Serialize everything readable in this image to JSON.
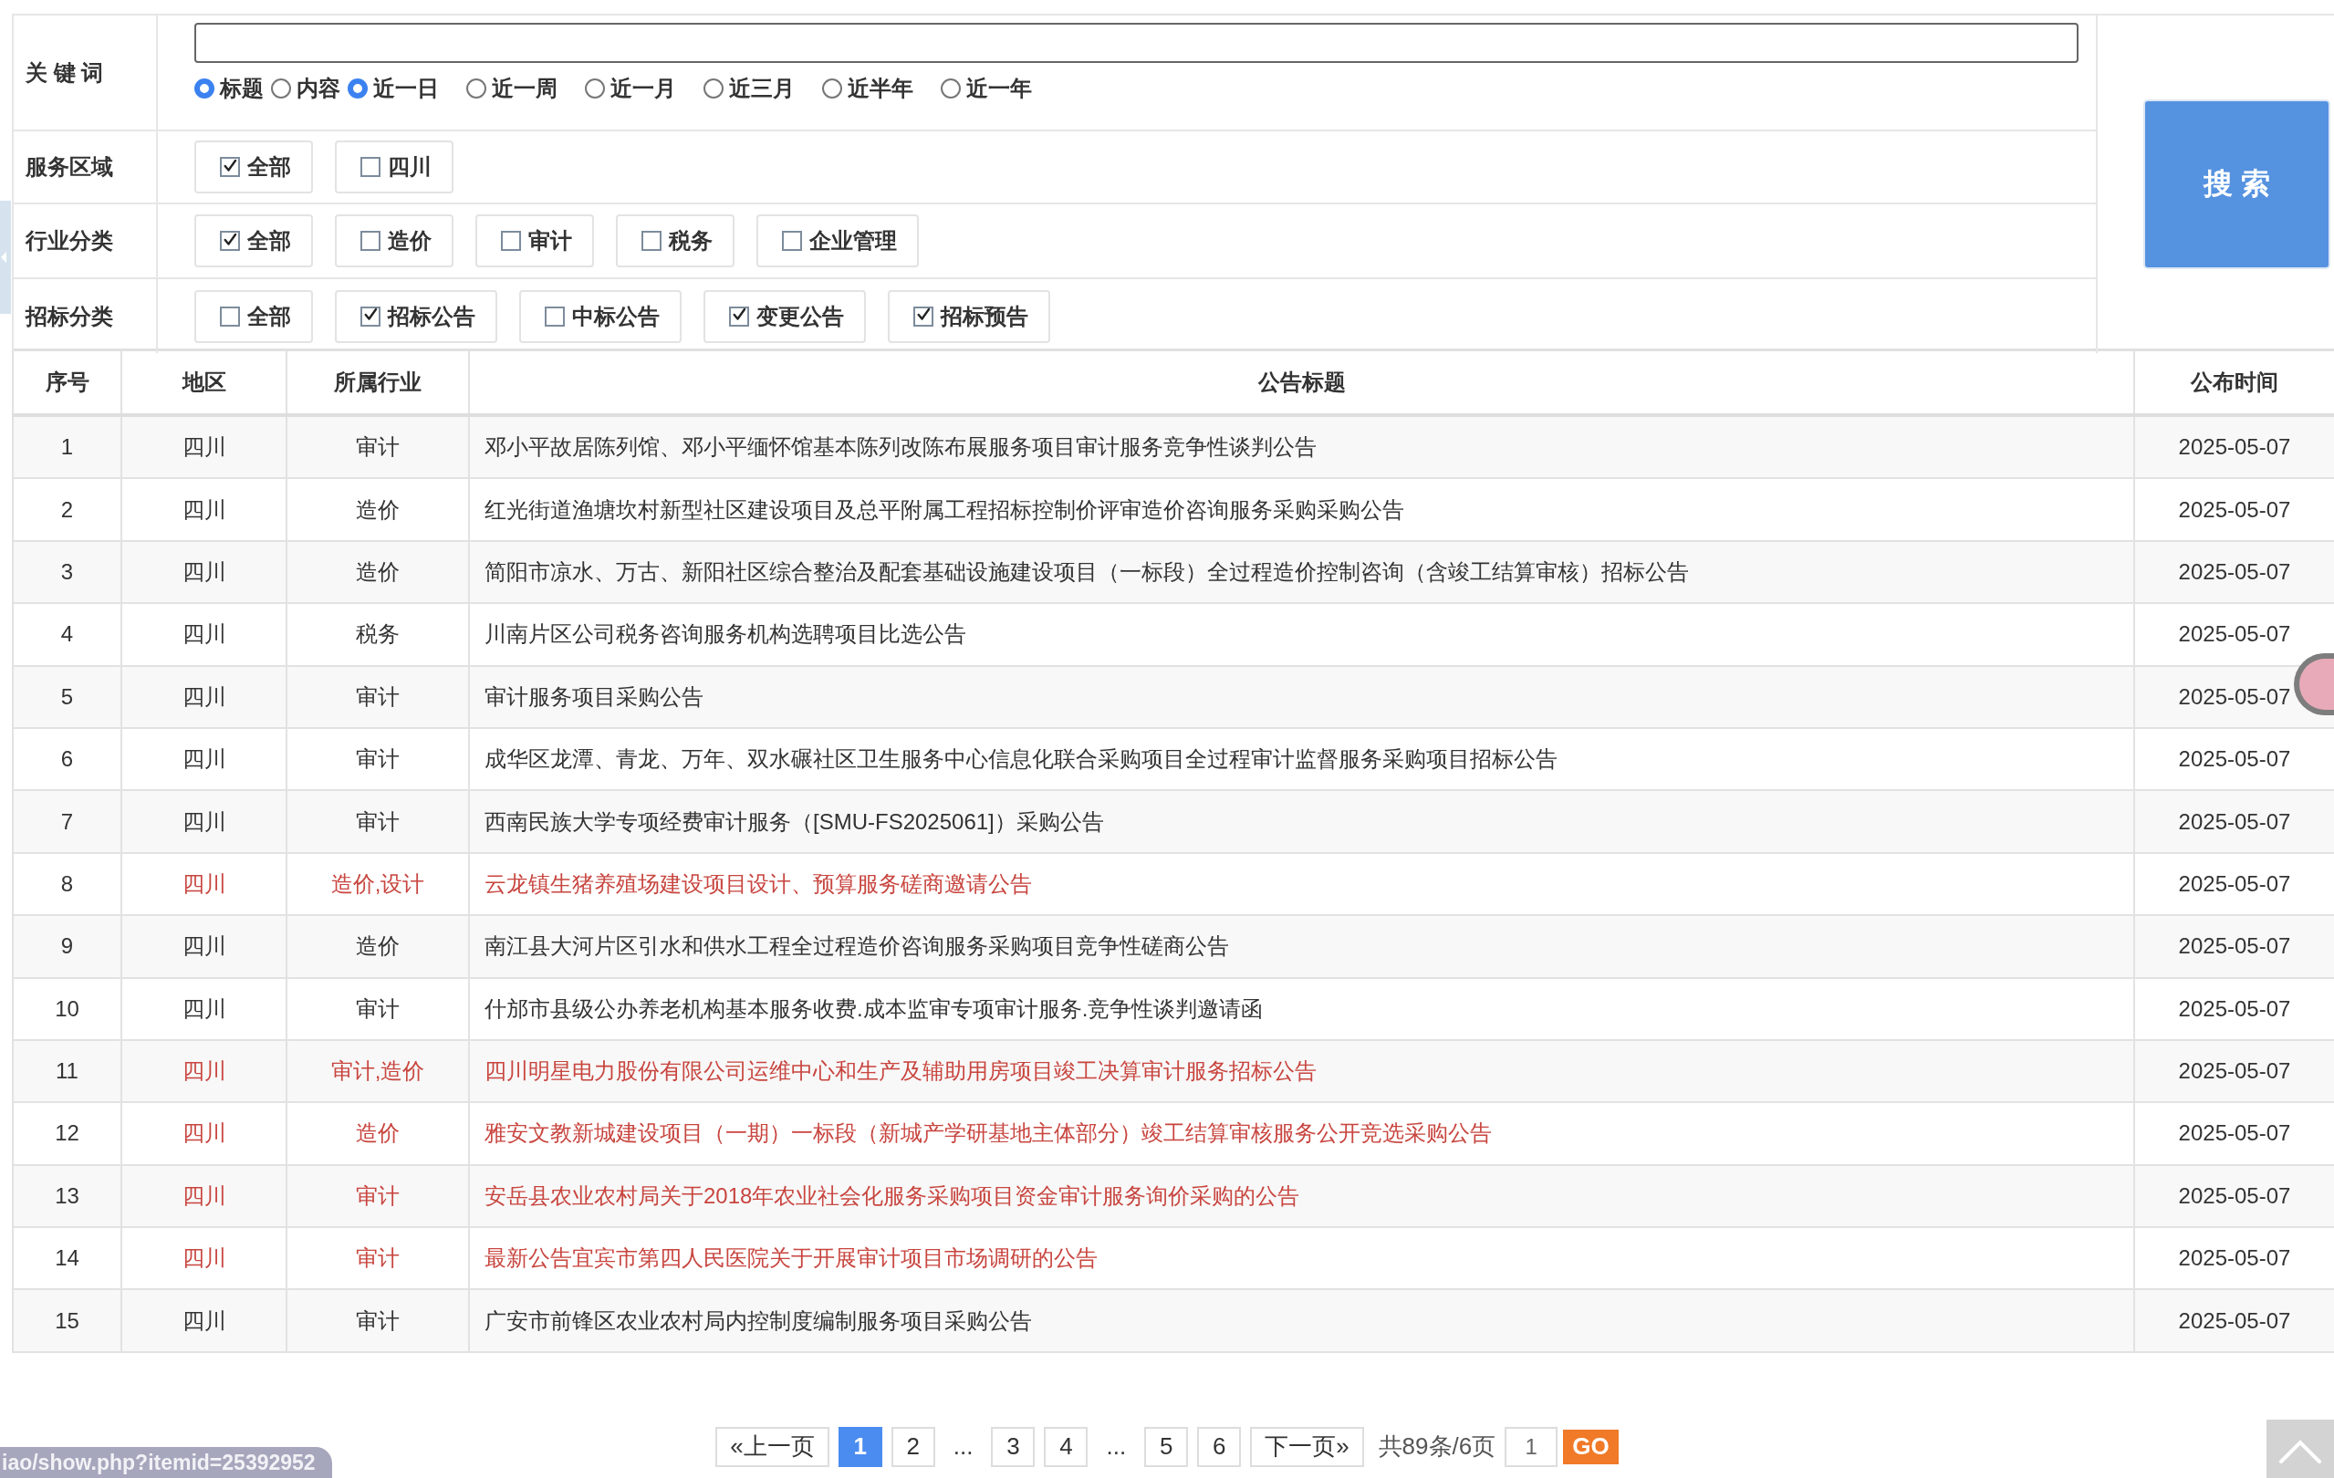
{
  "filters": {
    "keyword_label": "关 键 词",
    "scope_options": [
      {
        "label": "标题",
        "selected": true
      },
      {
        "label": "内容",
        "selected": false
      }
    ],
    "time_options": [
      {
        "label": "近一日",
        "selected": true
      },
      {
        "label": "近一周",
        "selected": false
      },
      {
        "label": "近一月",
        "selected": false
      },
      {
        "label": "近三月",
        "selected": false
      },
      {
        "label": "近半年",
        "selected": false
      },
      {
        "label": "近一年",
        "selected": false
      }
    ],
    "groups": [
      {
        "label": "服务区域",
        "options": [
          {
            "label": "全部",
            "checked": true
          },
          {
            "label": "四川",
            "checked": false
          }
        ]
      },
      {
        "label": "行业分类",
        "options": [
          {
            "label": "全部",
            "checked": true
          },
          {
            "label": "造价",
            "checked": false
          },
          {
            "label": "审计",
            "checked": false
          },
          {
            "label": "税务",
            "checked": false
          },
          {
            "label": "企业管理",
            "checked": false
          }
        ]
      },
      {
        "label": "招标分类",
        "options": [
          {
            "label": "全部",
            "checked": false
          },
          {
            "label": "招标公告",
            "checked": true
          },
          {
            "label": "中标公告",
            "checked": false
          },
          {
            "label": "变更公告",
            "checked": true
          },
          {
            "label": "招标预告",
            "checked": true
          }
        ]
      }
    ],
    "search_button": "搜 索"
  },
  "table": {
    "columns": [
      "序号",
      "地区",
      "所属行业",
      "公告标题",
      "公布时间"
    ],
    "rows": [
      {
        "cells": [
          "1",
          "四川",
          "审计",
          "邓小平故居陈列馆、邓小平缅怀馆基本陈列改陈布展服务项目审计服务竞争性谈判公告",
          "2025-05-07"
        ],
        "highlighted": false
      },
      {
        "cells": [
          "2",
          "四川",
          "造价",
          "红光街道渔塘坎村新型社区建设项目及总平附属工程招标控制价评审造价咨询服务采购采购公告",
          "2025-05-07"
        ],
        "highlighted": false
      },
      {
        "cells": [
          "3",
          "四川",
          "造价",
          "简阳市凉水、万古、新阳社区综合整治及配套基础设施建设项目（一标段）全过程造价控制咨询（含竣工结算审核）招标公告",
          "2025-05-07"
        ],
        "highlighted": false
      },
      {
        "cells": [
          "4",
          "四川",
          "税务",
          "川南片区公司税务咨询服务机构选聘项目比选公告",
          "2025-05-07"
        ],
        "highlighted": false
      },
      {
        "cells": [
          "5",
          "四川",
          "审计",
          "审计服务项目采购公告",
          "2025-05-07"
        ],
        "highlighted": false
      },
      {
        "cells": [
          "6",
          "四川",
          "审计",
          "成华区龙潭、青龙、万年、双水碾社区卫生服务中心信息化联合采购项目全过程审计监督服务采购项目招标公告",
          "2025-05-07"
        ],
        "highlighted": false
      },
      {
        "cells": [
          "7",
          "四川",
          "审计",
          "西南民族大学专项经费审计服务（[SMU-FS2025061]）采购公告",
          "2025-05-07"
        ],
        "highlighted": false
      },
      {
        "cells": [
          "8",
          "四川",
          "造价,设计",
          "云龙镇生猪养殖场建设项目设计、预算服务磋商邀请公告",
          "2025-05-07"
        ],
        "highlighted": true
      },
      {
        "cells": [
          "9",
          "四川",
          "造价",
          "南江县大河片区引水和供水工程全过程造价咨询服务采购项目竞争性磋商公告",
          "2025-05-07"
        ],
        "highlighted": false
      },
      {
        "cells": [
          "10",
          "四川",
          "审计",
          "什邡市县级公办养老机构基本服务收费.成本监审专项审计服务.竞争性谈判邀请函",
          "2025-05-07"
        ],
        "highlighted": false
      },
      {
        "cells": [
          "11",
          "四川",
          "审计,造价",
          "四川明星电力股份有限公司运维中心和生产及辅助用房项目竣工决算审计服务招标公告",
          "2025-05-07"
        ],
        "highlighted": true
      },
      {
        "cells": [
          "12",
          "四川",
          "造价",
          "雅安文教新城建设项目（一期）一标段（新城产学研基地主体部分）竣工结算审核服务公开竞选采购公告",
          "2025-05-07"
        ],
        "highlighted": true
      },
      {
        "cells": [
          "13",
          "四川",
          "审计",
          "安岳县农业农村局关于2018年农业社会化服务采购项目资金审计服务询价采购的公告",
          "2025-05-07"
        ],
        "highlighted": true
      },
      {
        "cells": [
          "14",
          "四川",
          "审计",
          "最新公告宜宾市第四人民医院关于开展审计项目市场调研的公告",
          "2025-05-07"
        ],
        "highlighted": true
      },
      {
        "cells": [
          "15",
          "四川",
          "审计",
          "广安市前锋区农业农村局内控制度编制服务项目采购公告",
          "2025-05-07"
        ],
        "highlighted": false
      }
    ]
  },
  "pagination": {
    "prev": "«上一页",
    "items": [
      {
        "kind": "page",
        "label": "1",
        "selected": true
      },
      {
        "kind": "page",
        "label": "2",
        "selected": false
      },
      {
        "kind": "ellipsis",
        "label": "..."
      },
      {
        "kind": "page",
        "label": "3",
        "selected": false
      },
      {
        "kind": "page",
        "label": "4",
        "selected": false
      },
      {
        "kind": "ellipsis",
        "label": "..."
      },
      {
        "kind": "page",
        "label": "5",
        "selected": false
      },
      {
        "kind": "page",
        "label": "6",
        "selected": false
      }
    ],
    "next": "下一页»",
    "summary": "共89条/6页",
    "jump_value": "1",
    "go": "GO"
  },
  "status_url": "iao/show.php?itemid=25392952"
}
